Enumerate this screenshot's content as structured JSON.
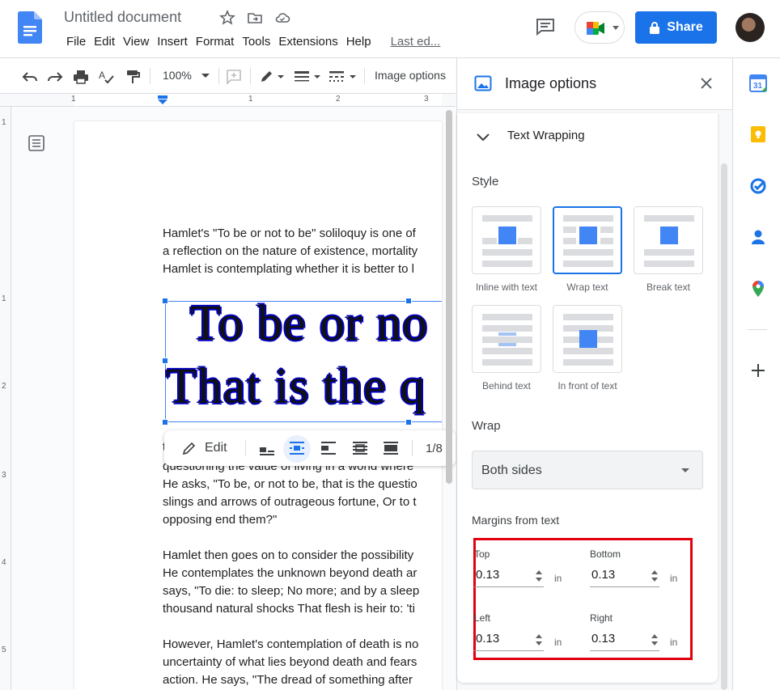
{
  "header": {
    "doc_title": "Untitled document",
    "menu": [
      "File",
      "Edit",
      "View",
      "Insert",
      "Format",
      "Tools",
      "Extensions",
      "Help"
    ],
    "last_edit": "Last ed...",
    "share_label": "Share"
  },
  "toolbar": {
    "zoom": "100%",
    "image_options": "Image options"
  },
  "ruler": {
    "h_ticks": [
      "1",
      "1",
      "1",
      "2",
      "3"
    ],
    "v_ticks": [
      "1",
      "1",
      "2",
      "3",
      "4",
      "5"
    ]
  },
  "document": {
    "para1": [
      "Hamlet's \"To be or not to be\" soliloquy is one of",
      "a reflection on the nature of existence, mortality",
      "Hamlet is contemplating whether it is better to l"
    ],
    "image_text": [
      "To be or no",
      "That is the q"
    ],
    "para2_first": "t",
    "para2": [
      "questioning the value of living in a world where",
      "He asks, \"To be, or not to be, that is the questio",
      "slings and arrows of outrageous fortune, Or to t",
      "opposing end them?\""
    ],
    "para3": [
      "Hamlet then goes on to consider the possibility",
      "He contemplates the unknown beyond death ar",
      "says, \"To die: to sleep; No more; and by a sleep",
      "thousand natural shocks That flesh is heir to: 'ti"
    ],
    "para4": [
      "However, Hamlet's contemplation of death is no",
      "uncertainty of what lies beyond death and fears",
      "action. He says, \"The dread of something after"
    ]
  },
  "image_toolbar": {
    "edit_label": "Edit",
    "page_count": "1/8"
  },
  "panel": {
    "title": "Image options",
    "section": "Text Wrapping",
    "style_label": "Style",
    "styles": [
      {
        "label": "Inline with text",
        "selected": false
      },
      {
        "label": "Wrap text",
        "selected": true
      },
      {
        "label": "Break text",
        "selected": false
      },
      {
        "label": "Behind text",
        "selected": false
      },
      {
        "label": "In front of text",
        "selected": false
      }
    ],
    "wrap_label": "Wrap",
    "wrap_value": "Both sides",
    "margins_label": "Margins from text",
    "margins": {
      "top": {
        "label": "Top",
        "value": "0.13",
        "unit": "in"
      },
      "bottom": {
        "label": "Bottom",
        "value": "0.13",
        "unit": "in"
      },
      "left": {
        "label": "Left",
        "value": "0.13",
        "unit": "in"
      },
      "right": {
        "label": "Right",
        "value": "0.13",
        "unit": "in"
      }
    }
  },
  "colors": {
    "accent": "#1a73e8",
    "highlight_box": "#e0000f"
  }
}
